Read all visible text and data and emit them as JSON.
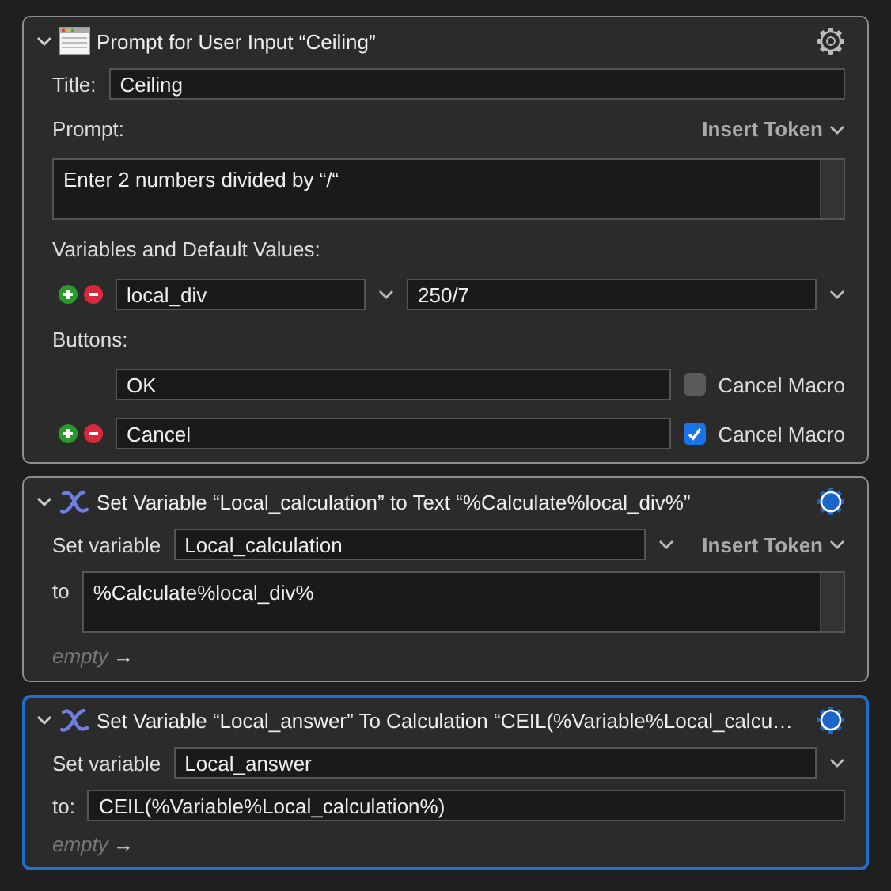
{
  "actions": [
    {
      "kind": "prompt",
      "expanded": true,
      "selected": false,
      "gear_active": false,
      "title": "Prompt for User Input “Ceiling”",
      "title_label": "Title:",
      "title_value": "Ceiling",
      "prompt_label": "Prompt:",
      "insert_token": "Insert Token",
      "prompt_value": "Enter 2 numbers divided by “/“",
      "variables_label": "Variables and Default Values:",
      "variables": [
        {
          "name": "local_div",
          "default": "250/7",
          "controls": true
        }
      ],
      "buttons_label": "Buttons:",
      "buttons": [
        {
          "label": "OK",
          "cancel_macro": false,
          "cancel_label": "Cancel Macro",
          "controls": false
        },
        {
          "label": "Cancel",
          "cancel_macro": true,
          "cancel_label": "Cancel Macro",
          "controls": true
        }
      ]
    },
    {
      "kind": "set_text",
      "expanded": true,
      "selected": false,
      "gear_active": true,
      "title": "Set Variable “Local_calculation” to Text “%Calculate%local_div%”",
      "set_label": "Set variable",
      "variable": "Local_calculation",
      "insert_token": "Insert Token",
      "to_label": "to",
      "value": "%Calculate%local_div%",
      "next_label": "empty",
      "next_arrow": "→"
    },
    {
      "kind": "set_calc",
      "expanded": true,
      "selected": true,
      "gear_active": true,
      "title": "Set Variable “Local_answer” To Calculation “CEIL(%Variable%Local_calcu…",
      "set_label": "Set variable",
      "variable": "Local_answer",
      "to_label": "to:",
      "value": "CEIL(%Variable%Local_calculation%)",
      "next_label": "empty",
      "next_arrow": "→"
    }
  ]
}
